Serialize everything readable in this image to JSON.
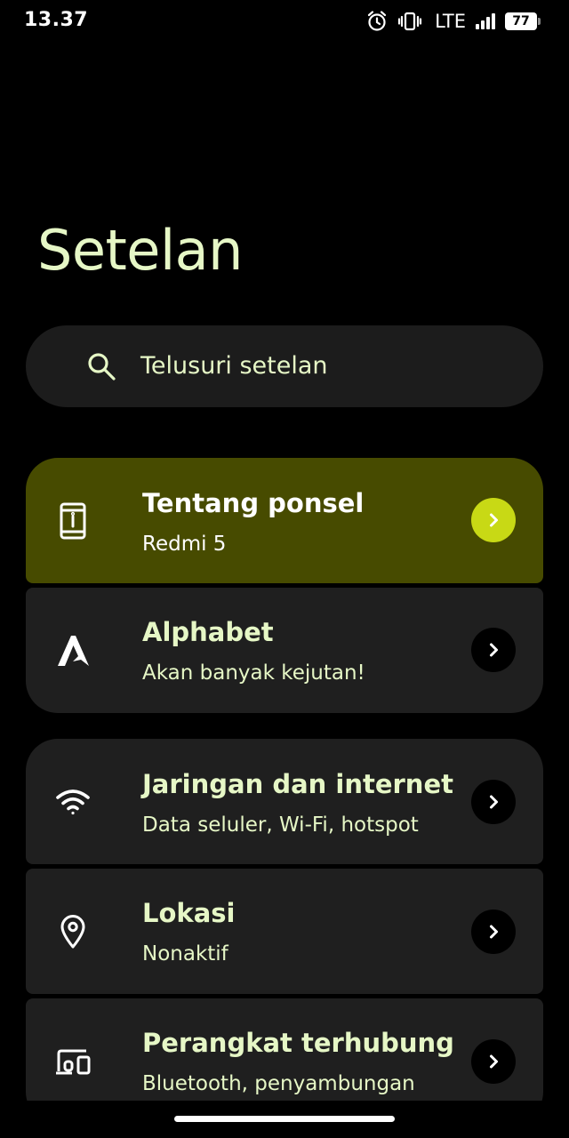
{
  "status_bar": {
    "time": "13.37",
    "network": "LTE",
    "battery": "77"
  },
  "page": {
    "title": "Setelan"
  },
  "search": {
    "placeholder": "Telusuri setelan"
  },
  "items": [
    {
      "title": "Tentang ponsel",
      "subtitle": "Redmi 5",
      "icon": "phone-info-icon",
      "highlighted": true
    },
    {
      "title": "Alphabet",
      "subtitle": "Akan banyak kejutan!",
      "icon": "alphabet-logo-icon"
    },
    {
      "title": "Jaringan dan internet",
      "subtitle": "Data seluler, Wi-Fi, hotspot",
      "icon": "wifi-icon"
    },
    {
      "title": "Lokasi",
      "subtitle": "Nonaktif",
      "icon": "location-pin-icon"
    },
    {
      "title": "Perangkat terhubung",
      "subtitle": "Bluetooth, penyambungan",
      "icon": "connected-devices-icon"
    }
  ],
  "colors": {
    "background": "#000000",
    "card": "#1f1f1f",
    "highlight_card": "#474b00",
    "highlight_chevron": "#c8d915",
    "text": "#e6f7c6"
  }
}
